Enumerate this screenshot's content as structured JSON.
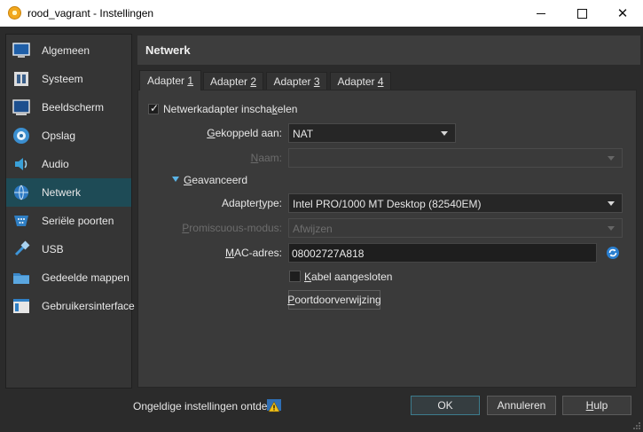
{
  "window": {
    "title": "rood_vagrant - Instellingen",
    "icon": "virtualbox-icon"
  },
  "sidebar": {
    "items": [
      {
        "label": "Algemeen",
        "icon": "monitor-icon"
      },
      {
        "label": "Systeem",
        "icon": "chip-icon"
      },
      {
        "label": "Beeldscherm",
        "icon": "display-icon"
      },
      {
        "label": "Opslag",
        "icon": "disk-icon"
      },
      {
        "label": "Audio",
        "icon": "speaker-icon"
      },
      {
        "label": "Netwerk",
        "icon": "network-icon",
        "active": true
      },
      {
        "label": "Seriële poorten",
        "icon": "serial-port-icon"
      },
      {
        "label": "USB",
        "icon": "usb-icon"
      },
      {
        "label": "Gedeelde mappen",
        "icon": "folder-icon"
      },
      {
        "label": "Gebruikersinterface",
        "icon": "ui-icon"
      }
    ]
  },
  "main": {
    "title": "Netwerk",
    "tabs": [
      {
        "label_pre": "Adapter ",
        "label_u": "1",
        "active": true
      },
      {
        "label_pre": "Adapter ",
        "label_u": "2"
      },
      {
        "label_pre": "Adapter ",
        "label_u": "3"
      },
      {
        "label_pre": "Adapter ",
        "label_u": "4"
      }
    ],
    "enable_adapter": {
      "label_pre": "Netwerkadapter inscha",
      "label_u": "k",
      "label_post": "elen",
      "checked": true
    },
    "attached_to": {
      "label_u": "G",
      "label_post": "ekoppeld aan:",
      "value": "NAT"
    },
    "name": {
      "label_u": "N",
      "label_post": "aam:",
      "value": ""
    },
    "advanced": {
      "label_u": "G",
      "label_post": "eavanceerd"
    },
    "adapter_type": {
      "label_pre": "Adapter",
      "label_u": "t",
      "label_post": "ype:",
      "value": "Intel PRO/1000 MT Desktop (82540EM)"
    },
    "promiscuous": {
      "label_u": "P",
      "label_post": "romiscuous-modus:",
      "value": "Afwijzen"
    },
    "mac": {
      "label_u": "M",
      "label_post": "AC-adres:",
      "value": "08002727A818"
    },
    "cable": {
      "label_u": "K",
      "label_post": "abel aangesloten",
      "checked": false
    },
    "port_forwarding": {
      "label_u": "P",
      "label_post": "oortdoorverwijzing"
    }
  },
  "footer": {
    "status": "Ongeldige instellingen ontdekt",
    "ok": "OK",
    "cancel": "Annuleren",
    "help_u": "H",
    "help_post": "ulp"
  },
  "colors": {
    "accent": "#1e4b56",
    "background": "#2b2b2b",
    "panel": "#3a3a3a"
  }
}
